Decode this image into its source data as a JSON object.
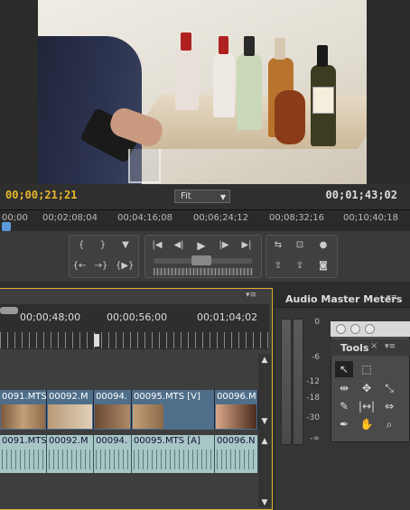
{
  "monitor": {
    "current_timecode": "00;00;21;21",
    "duration_timecode": "00;01;43;02",
    "zoom": "Fit",
    "ruler_ticks": [
      "00;00",
      "00;02;08;04",
      "00;04;16;08",
      "00;06;24;12",
      "00;08;32;16",
      "00;10;40;18"
    ]
  },
  "timeline": {
    "ruler_ticks": [
      "00;00;48;00",
      "00;00;56;00",
      "00;01;04;02"
    ],
    "video_clips": [
      "0091.MTS",
      "00092.M",
      "00094.",
      "00095.MTS [V]",
      "00096.M"
    ],
    "audio_clips": [
      "0091.MTS",
      "00092.M",
      "00094.",
      "00095.MTS [A]",
      "00096.N"
    ]
  },
  "audio_meters": {
    "title": "Audio Master Meters",
    "labels": [
      "0",
      "-6",
      "-12",
      "-18",
      "-30",
      "-∞"
    ]
  },
  "tools": {
    "title": "Tools"
  },
  "colors": {
    "timecode_current": "#e8b92a",
    "panel_border_active": "#e0b030",
    "video_track": "#4f6e8a",
    "audio_track": "#a8c6c6"
  }
}
